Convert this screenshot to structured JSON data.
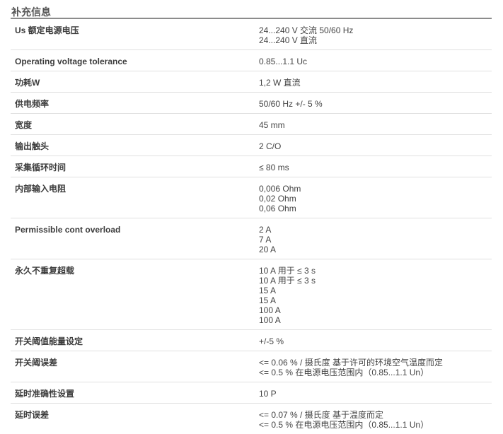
{
  "section": {
    "title": "补充信息"
  },
  "rows": [
    {
      "label": "Us 额定电源电压",
      "values": [
        "24...240 V 交流 50/60 Hz",
        "24...240 V 直流"
      ]
    },
    {
      "label": "Operating voltage tolerance",
      "values": [
        "0.85...1.1 Uc"
      ]
    },
    {
      "label": "功耗W",
      "values": [
        "1,2 W 直流"
      ]
    },
    {
      "label": "供电频率",
      "values": [
        "50/60 Hz +/- 5 %"
      ]
    },
    {
      "label": "宽度",
      "values": [
        "45 mm"
      ]
    },
    {
      "label": "输出触头",
      "values": [
        "2 C/O"
      ]
    },
    {
      "label": "采集循环时间",
      "values": [
        "≤ 80 ms"
      ]
    },
    {
      "label": "内部输入电阻",
      "values": [
        "0,006 Ohm",
        "0,02 Ohm",
        "0,06 Ohm"
      ]
    },
    {
      "label": "Permissible cont overload",
      "values": [
        "2 A",
        "7 A",
        "20 A"
      ]
    },
    {
      "label": "永久不重复超载",
      "values": [
        "10 A 用于 ≤ 3 s",
        "10 A 用于 ≤ 3 s",
        "15 A",
        "15 A",
        "100 A",
        "100 A"
      ]
    },
    {
      "label": "开关阈值能量设定",
      "values": [
        "+/-5 %"
      ]
    },
    {
      "label": "开关阈误差",
      "values": [
        "<= 0.06 % / 摄氏度 基于许可的环境空气温度而定",
        "<= 0.5 % 在电源电压范围内（0.85...1.1 Un）"
      ]
    },
    {
      "label": "延时准确性设置",
      "values": [
        "10 P"
      ]
    },
    {
      "label": "延时误差",
      "values": [
        "<= 0.07 % / 摄氏度 基于温度而定",
        "<= 0.5 % 在电源电压范围内（0.85...1.1 Un）"
      ]
    }
  ]
}
